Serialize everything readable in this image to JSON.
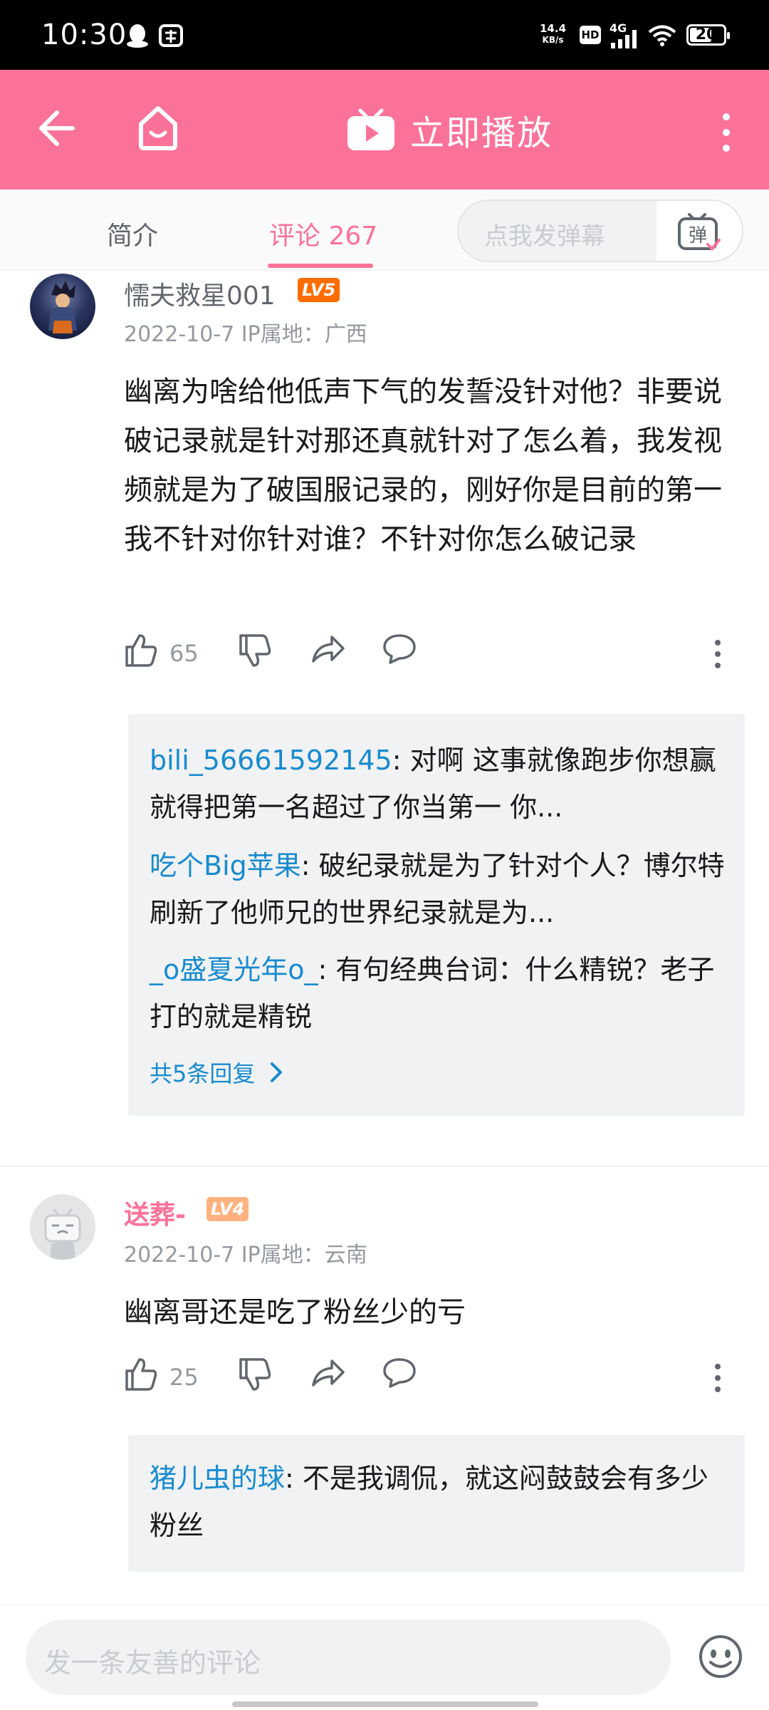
{
  "status_bar": {
    "time": "10:30",
    "net_speed_value": "14.4",
    "net_speed_unit": "KB/s",
    "hd": "HD",
    "signal": "4G",
    "battery": "20"
  },
  "top_bar": {
    "play_label": "立即播放"
  },
  "tabs": {
    "intro": "简介",
    "comments": "评论 267",
    "danmu_placeholder": "点我发弹幕",
    "danmu_button": "弹"
  },
  "comments": [
    {
      "username": "懦夫救星001",
      "level": "LV5",
      "meta": "2022-10-7  IP属地：广西",
      "text": "幽离为啥给他低声下气的发誓没针对他？非要说破记录就是针对那还真就针对了怎么着，我发视频就是为了破国服记录的，刚好你是目前的第一我不针对你针对谁？不针对你怎么破记录",
      "likes": "65",
      "replies": [
        {
          "name": "bili_56661592145",
          "text": ": 对啊 这事就像跑步你想赢就得把第一名超过了你当第一 你..."
        },
        {
          "name": "吃个Big苹果",
          "text": ": 破纪录就是为了针对个人？博尔特刷新了他师兄的世界纪录就是为..."
        },
        {
          "name": "_o盛夏光年o_",
          "text": ": 有句经典台词：什么精锐？老子打的就是精锐"
        }
      ],
      "more_replies": "共5条回复"
    },
    {
      "username": "送葬-",
      "level": "LV4",
      "meta": "2022-10-7  IP属地：云南",
      "text": "幽离哥还是吃了粉丝少的亏",
      "likes": "25",
      "replies": [
        {
          "name": "猪儿虫的球",
          "text": ": 不是我调侃，就这闷鼓鼓会有多少粉丝"
        }
      ]
    }
  ],
  "bottom_bar": {
    "placeholder": "发一条友善的评论"
  },
  "colors": {
    "brand_pink": "#fb7299",
    "link_blue": "#178bcf",
    "lv5_orange": "#ff6c00",
    "lv4_orange": "#ffb27f"
  }
}
